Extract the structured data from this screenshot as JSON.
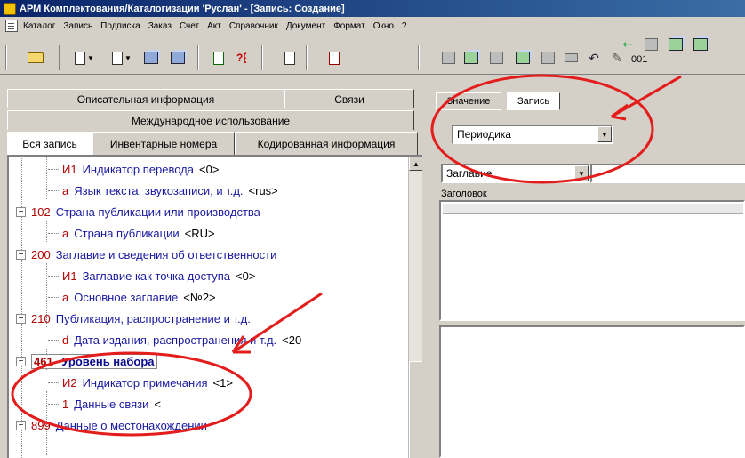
{
  "window": {
    "title": "АРМ Комплектования/Каталогизации 'Руслан' - [Запись: Создание]"
  },
  "menu": [
    "Каталог",
    "Запись",
    "Подписка",
    "Заказ",
    "Счет",
    "Акт",
    "Справочник",
    "Документ",
    "Формат",
    "Окно",
    "?"
  ],
  "toolbar": {
    "counter": "001"
  },
  "left_tabs": {
    "row1": [
      "Описательная информация",
      "Связи"
    ],
    "row2": [
      "Международное использование"
    ],
    "row3": [
      "Вся запись",
      "Инвентарные номера",
      "Кодированная информация"
    ]
  },
  "tree": [
    {
      "tag": "И1",
      "label": "Индикатор перевода",
      "value": "<0>"
    },
    {
      "tag": "a",
      "label": "Язык текста, звукозаписи, и т.д.",
      "value": "<rus>"
    },
    {
      "tag": "102",
      "label": "Страна публикации или производства",
      "value": ""
    },
    {
      "tag": "a",
      "label": "Страна публикации",
      "value": "<RU>"
    },
    {
      "tag": "200",
      "label": "Заглавие и сведения об ответственности",
      "value": ""
    },
    {
      "tag": "И1",
      "label": "Заглавие как точка доступа",
      "value": "<0>"
    },
    {
      "tag": "a",
      "label": "Основное заглавие",
      "value": "<№2>"
    },
    {
      "tag": "210",
      "label": "Публикация, распространение и т.д.",
      "value": ""
    },
    {
      "tag": "d",
      "label": "Дата издания, распространения и т.д.",
      "value": "<20"
    },
    {
      "tag": "461",
      "label": "Уровень набора",
      "value": ""
    },
    {
      "tag": "И2",
      "label": "Индикатор примечания",
      "value": "<1>"
    },
    {
      "tag": "1",
      "label": "Данные связи",
      "value": "<"
    },
    {
      "tag": "899",
      "label": "Данные о местонахождении",
      "value": ""
    }
  ],
  "right_tabs": [
    "Значение",
    "Запись"
  ],
  "right": {
    "combo1": "Периодика",
    "combo2": "Заглавие",
    "header_label": "Заголовок"
  },
  "colors": {
    "annotation": "#e31c1c",
    "tag": "#b00000",
    "label": "#1a1aa0"
  }
}
